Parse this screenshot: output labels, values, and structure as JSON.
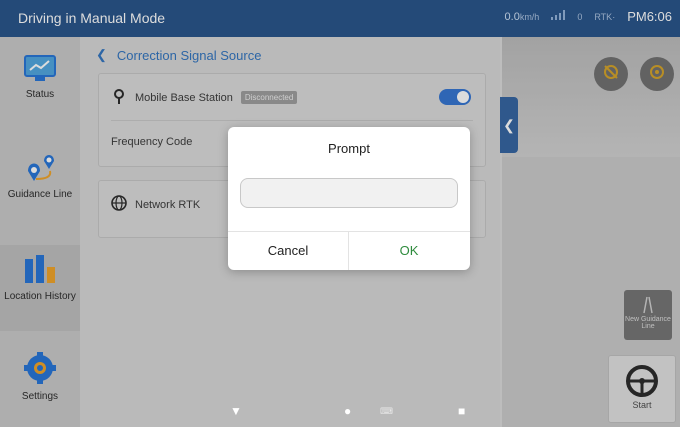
{
  "topbar": {
    "title": "Driving in Manual Mode",
    "speed": "0.0",
    "speed_unit": "km/h",
    "satellite_count": "0",
    "rtk_label": "RTK",
    "rtk_sub": "·",
    "time": "PM6:06"
  },
  "sidebar": {
    "items": [
      {
        "label": "Status",
        "icon": "status-icon"
      },
      {
        "label": "Guidance Line",
        "icon": "guidance-line-icon"
      },
      {
        "label": "Location History",
        "icon": "location-history-icon"
      },
      {
        "label": "Settings",
        "icon": "settings-icon"
      }
    ]
  },
  "main": {
    "breadcrumb": "Correction Signal Source",
    "mobile_base_station": {
      "label": "Mobile Base Station",
      "status": "Disconnected",
      "enabled": true
    },
    "frequency_code_label": "Frequency Code",
    "network_rtk": {
      "label": "Network RTK"
    }
  },
  "right_panel": {
    "new_guidance_line": "New Guidance Line",
    "start": "Start"
  },
  "dialog": {
    "title": "Prompt",
    "input_value": "",
    "cancel": "Cancel",
    "ok": "OK"
  },
  "colors": {
    "topbar": "#1f4e86",
    "accent": "#2d6fd0",
    "ok": "#2e8b3d",
    "settings": "#1e6fd6"
  }
}
